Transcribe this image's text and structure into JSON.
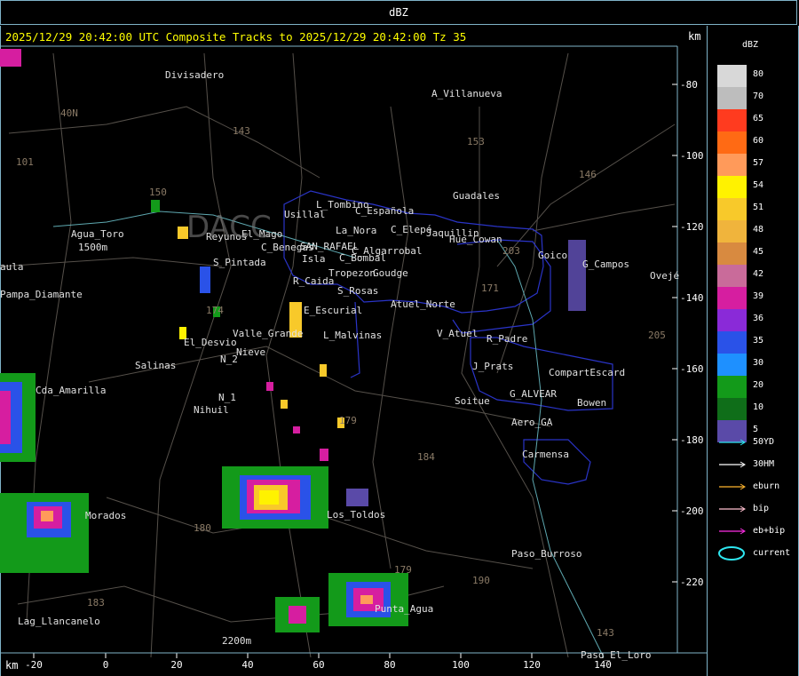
{
  "window_title": "dBZ",
  "title_line": "2025/12/29 20:42:00 UTC Composite Tracks to 2025/12/29 20:42:00 Tz 35",
  "km_top": "km",
  "km_bottom": "km",
  "legend": {
    "title": "dBZ",
    "levels": [
      {
        "label": "80",
        "color": "#d8d8d8"
      },
      {
        "label": "70",
        "color": "#bdbdbd"
      },
      {
        "label": "65",
        "color": "#ff3b1f"
      },
      {
        "label": "60",
        "color": "#ff6a14"
      },
      {
        "label": "57",
        "color": "#ff9a5a"
      },
      {
        "label": "54",
        "color": "#fff200"
      },
      {
        "label": "51",
        "color": "#f8c92a"
      },
      {
        "label": "48",
        "color": "#f0b43c"
      },
      {
        "label": "45",
        "color": "#d88a40"
      },
      {
        "label": "42",
        "color": "#c96b9a"
      },
      {
        "label": "39",
        "color": "#d61ea0"
      },
      {
        "label": "36",
        "color": "#8a2ad8"
      },
      {
        "label": "35",
        "color": "#2a52e8"
      },
      {
        "label": "30",
        "color": "#1e90ff"
      },
      {
        "label": "20",
        "color": "#139a1a"
      },
      {
        "label": "10",
        "color": "#0f6e19"
      },
      {
        "label": "5",
        "color": "#5a4aa8"
      }
    ],
    "tracks": [
      {
        "label": "50YD",
        "color": "#2ee6f0"
      },
      {
        "label": "30HM",
        "color": "#ffffff"
      },
      {
        "label": "eburn",
        "color": "#ffb52e"
      },
      {
        "label": "bip",
        "color": "#ffc0d0"
      },
      {
        "label": "eb+bip",
        "color": "#ff2ee6"
      },
      {
        "label": "current",
        "color": "#2ee6f0"
      }
    ]
  },
  "axis": {
    "x_ticks": [
      "-20",
      "0",
      "20",
      "40",
      "60",
      "80",
      "100",
      "120",
      "140"
    ],
    "y_ticks": [
      "-80",
      "-100",
      "-120",
      "-140",
      "-160",
      "-180",
      "-200",
      "-220"
    ]
  },
  "places": [
    "Divisadero",
    "A_Villanueva",
    "40N",
    "101",
    "143",
    "153",
    "146",
    "150",
    "Guadales",
    "Usillal",
    "L_Tombino",
    "C_Española",
    "La_Nora",
    "C_Elepé",
    "Jaquillin",
    "Hue_Cowan",
    "Goico",
    "G_Campos",
    "Ovejé",
    "Agua_Toro",
    "1500m",
    "Reyunos",
    "El_Mago",
    "C_Benegas",
    "SAN_RAFAEL",
    "C_Algarrobal",
    "C_Bombal",
    "S_Pintada",
    "Isla",
    "Tropezon",
    "Goudge",
    "R_Caida",
    "S_Rosas",
    "171",
    "Atuel_Norte",
    "203",
    "aula",
    "Pampa_Diamante",
    "E_Escurial",
    "Valle_Grande",
    "L_Malvinas",
    "V_Atuel",
    "R_Padre",
    "El_Desvio",
    "Salinas",
    "Nieve",
    "N_2",
    "N_1",
    "Nihuil",
    "J_Prats",
    "CompartEscard",
    "G_ALVEAR",
    "Bowen",
    "Soitue",
    "Aero_GA",
    "Cda_Amarilla",
    "Carmensa",
    "179",
    "184",
    "Morados",
    "180",
    "Los_Toldos",
    "Paso_Burroso",
    "190",
    "179",
    "183",
    "Lag_Llancanelo",
    "2200m",
    "Punta_Agua",
    "Paso_El_Loro",
    "143",
    "174",
    "205",
    "DACC"
  ]
}
